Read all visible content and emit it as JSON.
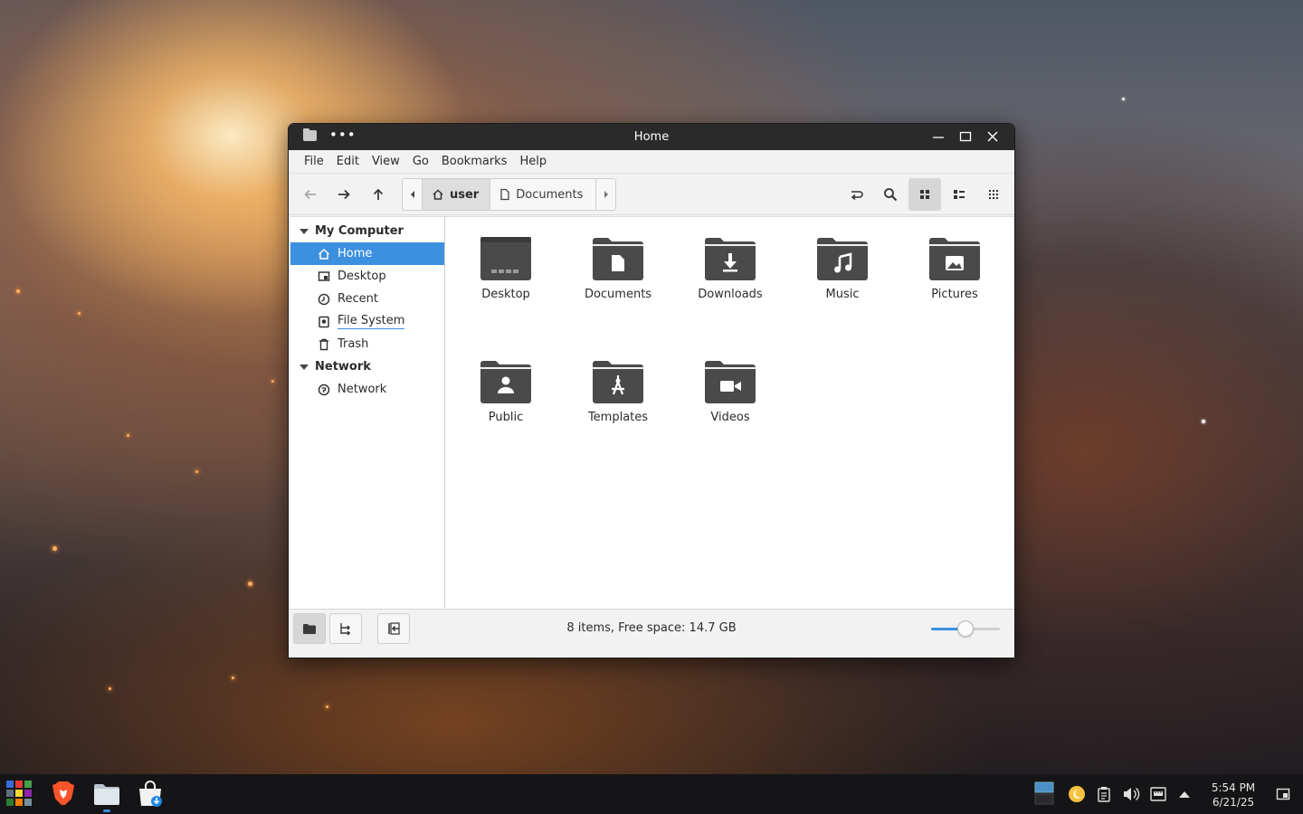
{
  "window": {
    "title": "Home",
    "menu": [
      "File",
      "Edit",
      "View",
      "Go",
      "Bookmarks",
      "Help"
    ]
  },
  "pathbar": {
    "crumbs": [
      "user",
      "Documents"
    ]
  },
  "sidebar": {
    "sections": [
      {
        "title": "My Computer",
        "items": [
          {
            "label": "Home",
            "icon": "home-icon",
            "selected": true
          },
          {
            "label": "Desktop",
            "icon": "desktop-icon"
          },
          {
            "label": "Recent",
            "icon": "clock-icon"
          },
          {
            "label": "File System",
            "icon": "drive-icon"
          },
          {
            "label": "Trash",
            "icon": "trash-icon"
          }
        ]
      },
      {
        "title": "Network",
        "items": [
          {
            "label": "Network",
            "icon": "network-icon"
          }
        ]
      }
    ]
  },
  "files": [
    {
      "label": "Desktop",
      "icon": "desktop-folder-icon"
    },
    {
      "label": "Documents",
      "icon": "documents-folder-icon"
    },
    {
      "label": "Downloads",
      "icon": "downloads-folder-icon"
    },
    {
      "label": "Music",
      "icon": "music-folder-icon"
    },
    {
      "label": "Pictures",
      "icon": "pictures-folder-icon"
    },
    {
      "label": "Public",
      "icon": "public-folder-icon"
    },
    {
      "label": "Templates",
      "icon": "templates-folder-icon"
    },
    {
      "label": "Videos",
      "icon": "videos-folder-icon"
    }
  ],
  "status": {
    "text": "8 items, Free space: 14.7 GB",
    "zoom_level": 0.5
  },
  "taskbar": {
    "time": "5:54 PM",
    "date": "6/21/25"
  },
  "colors": {
    "accent": "#3d8fe0",
    "folder": "#4a4a4a",
    "titlebar": "#2a2a2a",
    "taskbar": "#151517"
  }
}
